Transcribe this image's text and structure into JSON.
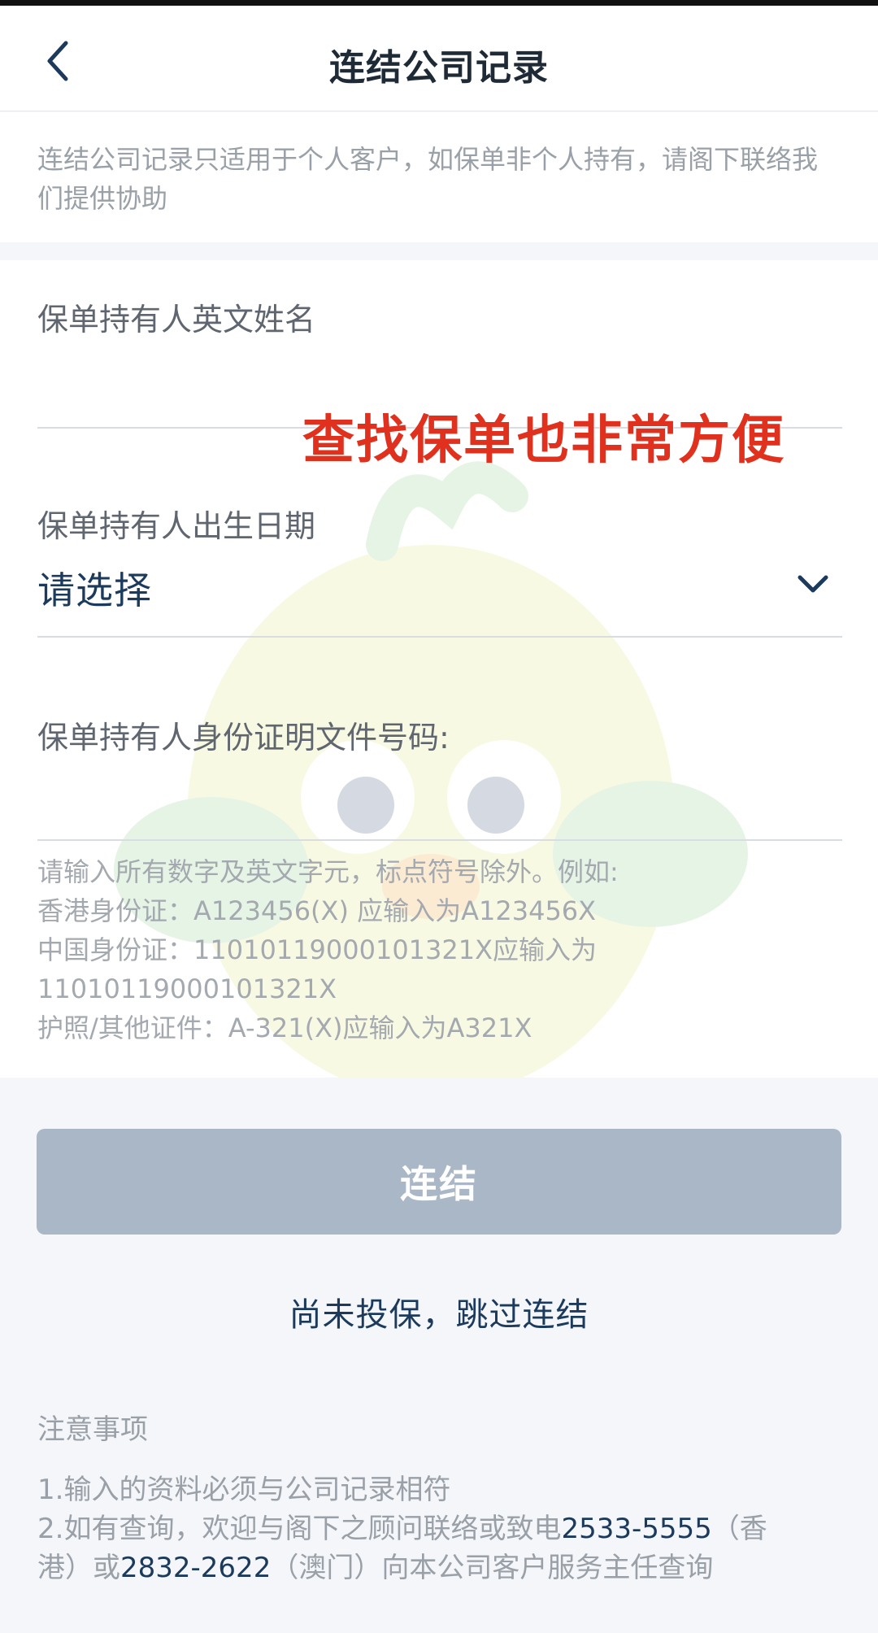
{
  "header": {
    "title": "连结公司记录"
  },
  "notice": "连结公司记录只适用于个人客户，如保单非个人持有，请阁下联络我们提供协助",
  "form": {
    "name_label": "保单持有人英文姓名",
    "name_value": "",
    "overlay_text": "查找保单也非常方便",
    "dob_label": "保单持有人出生日期",
    "dob_value": "请选择",
    "id_label": "保单持有人身份证明文件号码:",
    "id_value": "",
    "hint_lines": [
      "请输入所有数字及英文字元，标点符号除外。例如:",
      "香港身份证：A123456(X) 应输入为A123456X",
      "中国身份证：11010119000101321X应输入为",
      "11010119000101321X",
      "护照/其他证件：A-321(X)应输入为A321X"
    ]
  },
  "actions": {
    "connect_label": "连结",
    "skip_label": "尚未投保，跳过连结"
  },
  "notes": {
    "title": "注意事项",
    "item1": "1.输入的资料必须与公司记录相符",
    "item2_prefix": "2.如有查询，欢迎与阁下之顾问联络或致电",
    "phone_hk": "2533-5555",
    "item2_mid1": "（香",
    "item2_mid2": "港）或",
    "phone_macau": "2832-2622",
    "item2_suffix": "（澳门）向本公司客户服务主任查询"
  },
  "colors": {
    "accent_navy": "#1b3a5c",
    "button_disabled": "#aab7c7",
    "overlay_red": "#e0311e"
  }
}
